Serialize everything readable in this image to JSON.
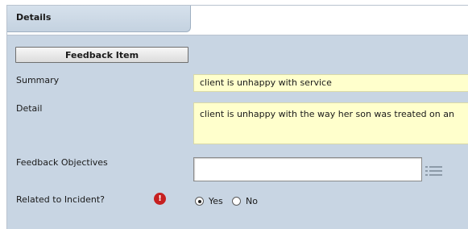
{
  "tabs": {
    "active_label": "Details"
  },
  "section": {
    "label": "Feedback Item"
  },
  "fields": {
    "summary": {
      "label": "Summary",
      "value": "client is unhappy with service"
    },
    "detail": {
      "label": "Detail",
      "value": "client is unhappy with the way her son was treated on an"
    },
    "objectives": {
      "label": "Feedback Objectives",
      "value": "",
      "icon": "list-icon"
    },
    "related_incident": {
      "label": "Related to Incident?",
      "alert_glyph": "!",
      "alert_color": "#c62020",
      "options": [
        {
          "label": "Yes",
          "checked": true
        },
        {
          "label": "No",
          "checked": false
        }
      ]
    }
  },
  "colors": {
    "panel_bg": "#c8d5e3",
    "field_bg": "#ffffcc",
    "tab_bg": "#d6e1ec"
  }
}
